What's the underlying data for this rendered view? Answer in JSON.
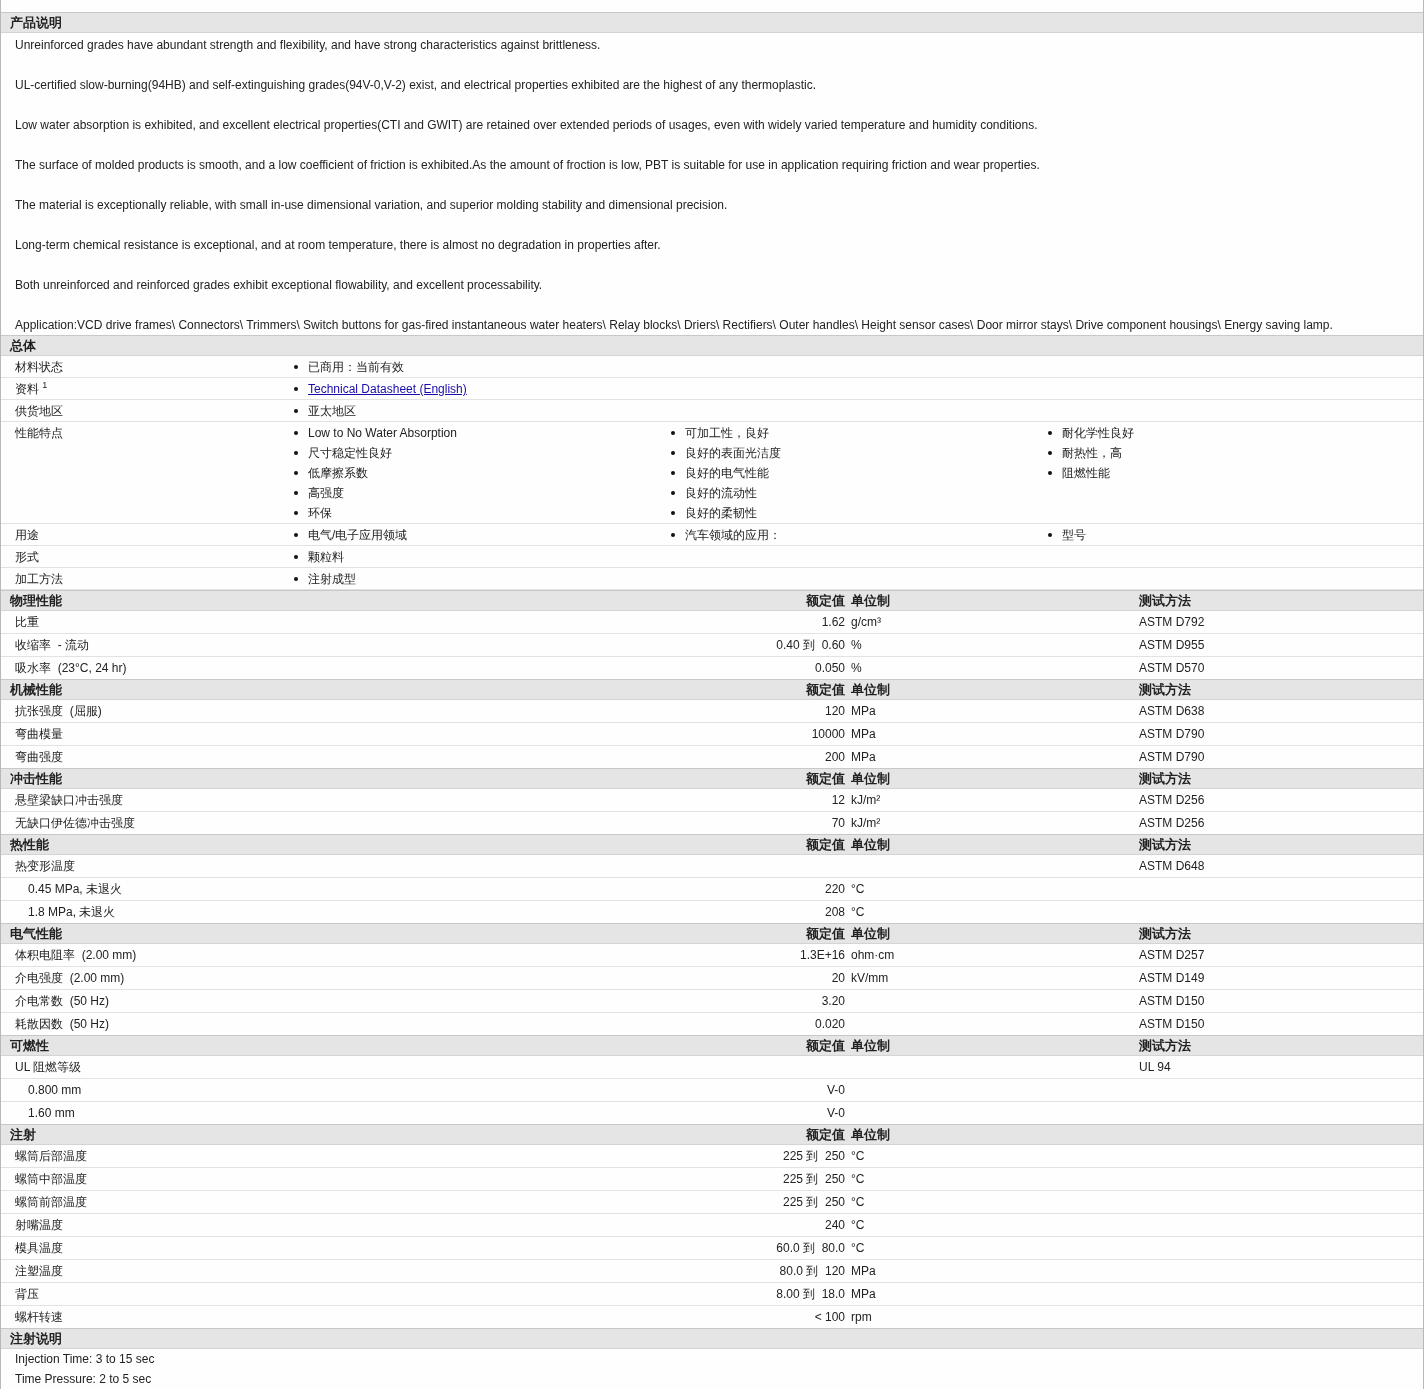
{
  "description": {
    "title": "产品说明",
    "paragraphs": [
      "Unreinforced grades have abundant strength and flexibility, and have strong characteristics against brittleness.",
      "UL-certified slow-burning(94HB) and self-extinguishing grades(94V-0,V-2) exist, and electrical properties exhibited are the highest of any thermoplastic.",
      "Low water absorption is exhibited, and excellent electrical properties(CTI and GWIT) are retained over extended periods of usages, even with widely varied temperature and humidity conditions.",
      "The surface of molded products is smooth, and a low coefficient of friction is exhibited.As the amount of froction is low, PBT is suitable for use in application requiring friction and wear properties.",
      "The material is exceptionally reliable, with small in-use dimensional variation, and superior molding stability and dimensional precision.",
      "Long-term chemical resistance is exceptional, and at room temperature, there is almost no degradation in properties after.",
      "Both unreinforced and reinforced grades exhibit exceptional flowability, and excellent processability.",
      "Application:VCD drive frames\\ Connectors\\ Trimmers\\ Switch buttons for gas-fired instantaneous water heaters\\ Relay blocks\\ Driers\\ Rectifiers\\ Outer handles\\ Height sensor cases\\ Door mirror stays\\ Drive component housings\\ Energy saving lamp."
    ]
  },
  "general": {
    "title": "总体",
    "rows": [
      {
        "label": "材料状态",
        "columns": [
          [
            {
              "text": "已商用：当前有效",
              "kind": "text"
            }
          ]
        ]
      },
      {
        "label": "资料 $^{1}$",
        "columns": [
          [
            {
              "text": "Technical Datasheet (English)",
              "kind": "link"
            }
          ]
        ]
      },
      {
        "label": "供货地区",
        "columns": [
          [
            {
              "text": "亚太地区",
              "kind": "text"
            }
          ]
        ]
      },
      {
        "label": "性能特点",
        "columns": [
          [
            {
              "text": "Low to No Water Absorption",
              "kind": "text"
            },
            {
              "text": "尺寸稳定性良好",
              "kind": "text"
            },
            {
              "text": "低摩擦系数",
              "kind": "text"
            },
            {
              "text": "高强度",
              "kind": "text"
            },
            {
              "text": "环保",
              "kind": "text"
            }
          ],
          [
            {
              "text": "可加工性，良好",
              "kind": "text"
            },
            {
              "text": "良好的表面光洁度",
              "kind": "text"
            },
            {
              "text": "良好的电气性能",
              "kind": "text"
            },
            {
              "text": "良好的流动性",
              "kind": "text"
            },
            {
              "text": "良好的柔韧性",
              "kind": "text"
            }
          ],
          [
            {
              "text": "耐化学性良好",
              "kind": "text"
            },
            {
              "text": "耐热性，高",
              "kind": "text"
            },
            {
              "text": "阻燃性能",
              "kind": "text"
            }
          ]
        ]
      },
      {
        "label": "用途",
        "columns": [
          [
            {
              "text": "电气/电子应用领域",
              "kind": "text"
            }
          ],
          [
            {
              "text": "汽车领域的应用：",
              "kind": "text"
            }
          ],
          [
            {
              "text": "型号",
              "kind": "text"
            }
          ]
        ]
      },
      {
        "label": "形式",
        "columns": [
          [
            {
              "text": "颗粒料",
              "kind": "text"
            }
          ]
        ]
      },
      {
        "label": "加工方法",
        "columns": [
          [
            {
              "text": "注射成型",
              "kind": "text"
            }
          ]
        ]
      }
    ]
  },
  "property_sections": [
    {
      "title": "物理性能",
      "headers": {
        "value": "额定值",
        "unit": "单位制",
        "method": "测试方法"
      },
      "rows": [
        {
          "label": "比重",
          "value": "1.62",
          "unit": "g/cm³",
          "method": "ASTM D792"
        },
        {
          "label": "收缩率  - 流动",
          "value": "0.40 到  0.60",
          "unit": "%",
          "method": "ASTM D955"
        },
        {
          "label": "吸水率  (23°C, 24 hr)",
          "value": "0.050",
          "unit": "%",
          "method": "ASTM D570"
        }
      ]
    },
    {
      "title": "机械性能",
      "headers": {
        "value": "额定值",
        "unit": "单位制",
        "method": "测试方法"
      },
      "rows": [
        {
          "label": "抗张强度  (屈服)",
          "value": "120",
          "unit": "MPa",
          "method": "ASTM D638"
        },
        {
          "label": "弯曲模量",
          "value": "10000",
          "unit": "MPa",
          "method": "ASTM D790"
        },
        {
          "label": "弯曲强度",
          "value": "200",
          "unit": "MPa",
          "method": "ASTM D790"
        }
      ]
    },
    {
      "title": "冲击性能",
      "headers": {
        "value": "额定值",
        "unit": "单位制",
        "method": "测试方法"
      },
      "rows": [
        {
          "label": "悬壁梁缺口冲击强度",
          "value": "12",
          "unit": "kJ/m²",
          "method": "ASTM D256"
        },
        {
          "label": "无缺口伊佐德冲击强度",
          "value": "70",
          "unit": "kJ/m²",
          "method": "ASTM D256"
        }
      ]
    },
    {
      "title": "热性能",
      "headers": {
        "value": "额定值",
        "unit": "单位制",
        "method": "测试方法"
      },
      "rows": [
        {
          "label": "热变形温度",
          "method": "ASTM D648",
          "children": [
            {
              "label": "0.45 MPa, 未退火",
              "value": "220",
              "unit": "°C"
            },
            {
              "label": "1.8 MPa, 未退火",
              "value": "208",
              "unit": "°C"
            }
          ]
        }
      ]
    },
    {
      "title": "电气性能",
      "headers": {
        "value": "额定值",
        "unit": "单位制",
        "method": "测试方法"
      },
      "rows": [
        {
          "label": "体积电阻率  (2.00 mm)",
          "value": "1.3E+16",
          "unit": "ohm·cm",
          "method": "ASTM D257"
        },
        {
          "label": "介电强度  (2.00 mm)",
          "value": "20",
          "unit": "kV/mm",
          "method": "ASTM D149"
        },
        {
          "label": "介电常数  (50 Hz)",
          "value": "3.20",
          "method": "ASTM D150"
        },
        {
          "label": "耗散因数  (50 Hz)",
          "value": "0.020",
          "method": "ASTM D150"
        }
      ]
    },
    {
      "title": "可燃性",
      "headers": {
        "value": "额定值",
        "unit": "单位制",
        "method": "测试方法"
      },
      "rows": [
        {
          "label": "UL 阻燃等级",
          "method": "UL 94",
          "children": [
            {
              "label": "0.800 mm",
              "value": "V-0"
            },
            {
              "label": "1.60 mm",
              "value": "V-0"
            }
          ]
        }
      ]
    },
    {
      "title": "注射",
      "headers": {
        "value": "额定值",
        "unit": "单位制"
      },
      "rows": [
        {
          "label": "螺筒后部温度",
          "value": "225 到  250",
          "unit": "°C"
        },
        {
          "label": "螺筒中部温度",
          "value": "225 到  250",
          "unit": "°C"
        },
        {
          "label": "螺筒前部温度",
          "value": "225 到  250",
          "unit": "°C"
        },
        {
          "label": "射嘴温度",
          "value": "240",
          "unit": "°C"
        },
        {
          "label": "模具温度",
          "value": "60.0 到  80.0",
          "unit": "°C"
        },
        {
          "label": "注塑温度",
          "value": "80.0 到  120",
          "unit": "MPa"
        },
        {
          "label": "背压",
          "value": "8.00 到  18.0",
          "unit": "MPa"
        },
        {
          "label": "螺杆转速",
          "value": "< 100",
          "unit": "rpm"
        }
      ]
    }
  ],
  "notes": {
    "title": "注射说明",
    "lines": [
      "Injection Time: 3 to 15 sec",
      "Time Pressure: 2 to 5 sec"
    ]
  }
}
